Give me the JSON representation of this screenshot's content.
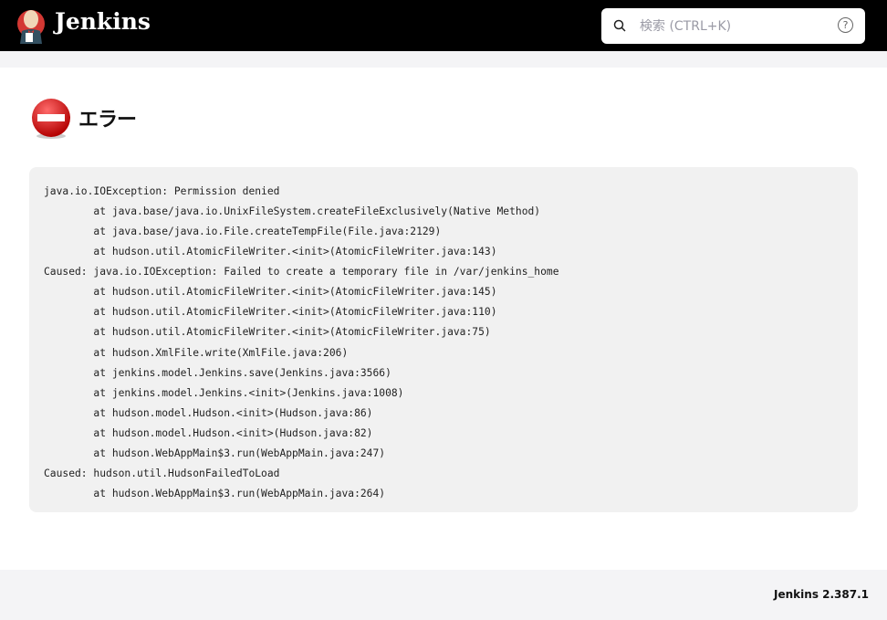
{
  "header": {
    "brand": "Jenkins",
    "search_placeholder": "検索 (CTRL+K)",
    "help": "?"
  },
  "page": {
    "title": "エラー"
  },
  "stack_trace": [
    "java.io.IOException: Permission denied",
    "\tat java.base/java.io.UnixFileSystem.createFileExclusively(Native Method)",
    "\tat java.base/java.io.File.createTempFile(File.java:2129)",
    "\tat hudson.util.AtomicFileWriter.<init>(AtomicFileWriter.java:143)",
    "Caused: java.io.IOException: Failed to create a temporary file in /var/jenkins_home",
    "\tat hudson.util.AtomicFileWriter.<init>(AtomicFileWriter.java:145)",
    "\tat hudson.util.AtomicFileWriter.<init>(AtomicFileWriter.java:110)",
    "\tat hudson.util.AtomicFileWriter.<init>(AtomicFileWriter.java:75)",
    "\tat hudson.XmlFile.write(XmlFile.java:206)",
    "\tat jenkins.model.Jenkins.save(Jenkins.java:3566)",
    "\tat jenkins.model.Jenkins.<init>(Jenkins.java:1008)",
    "\tat hudson.model.Hudson.<init>(Hudson.java:86)",
    "\tat hudson.model.Hudson.<init>(Hudson.java:82)",
    "\tat hudson.WebAppMain$3.run(WebAppMain.java:247)",
    "Caused: hudson.util.HudsonFailedToLoad",
    "\tat hudson.WebAppMain$3.run(WebAppMain.java:264)"
  ],
  "footer": {
    "version": "Jenkins 2.387.1"
  }
}
